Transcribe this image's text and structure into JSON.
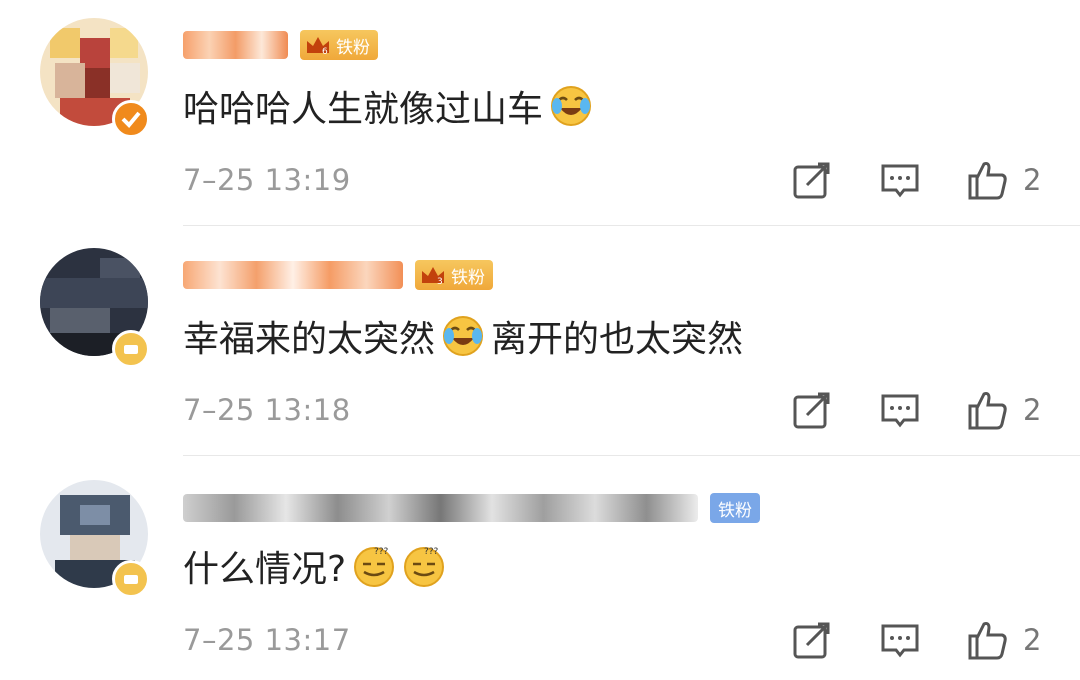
{
  "comments": [
    {
      "badge": "铁粉",
      "text": "哈哈哈人生就像过山车",
      "time": "7–25 13:19",
      "likes": "2",
      "emoji": [
        "laugh-cry-emoji"
      ]
    },
    {
      "badge": "铁粉",
      "text_before": "幸福来的太突然",
      "text_after": "离开的也太突然",
      "time": "7–25 13:18",
      "likes": "2",
      "emoji": [
        "laugh-cry-emoji"
      ]
    },
    {
      "badge": "铁粉",
      "text": "什么情况?",
      "time": "7–25 13:17",
      "likes": "2",
      "emoji": [
        "dizzy-emoji",
        "dizzy-emoji"
      ]
    }
  ],
  "icons": {
    "repost": "repost-icon",
    "reply": "comment-icon",
    "like": "thumbs-up-icon"
  },
  "colors": {
    "badge_gold": "#f0a83a",
    "badge_blue": "#7aa7e8",
    "text": "#222222",
    "meta": "#9a9a9a"
  }
}
